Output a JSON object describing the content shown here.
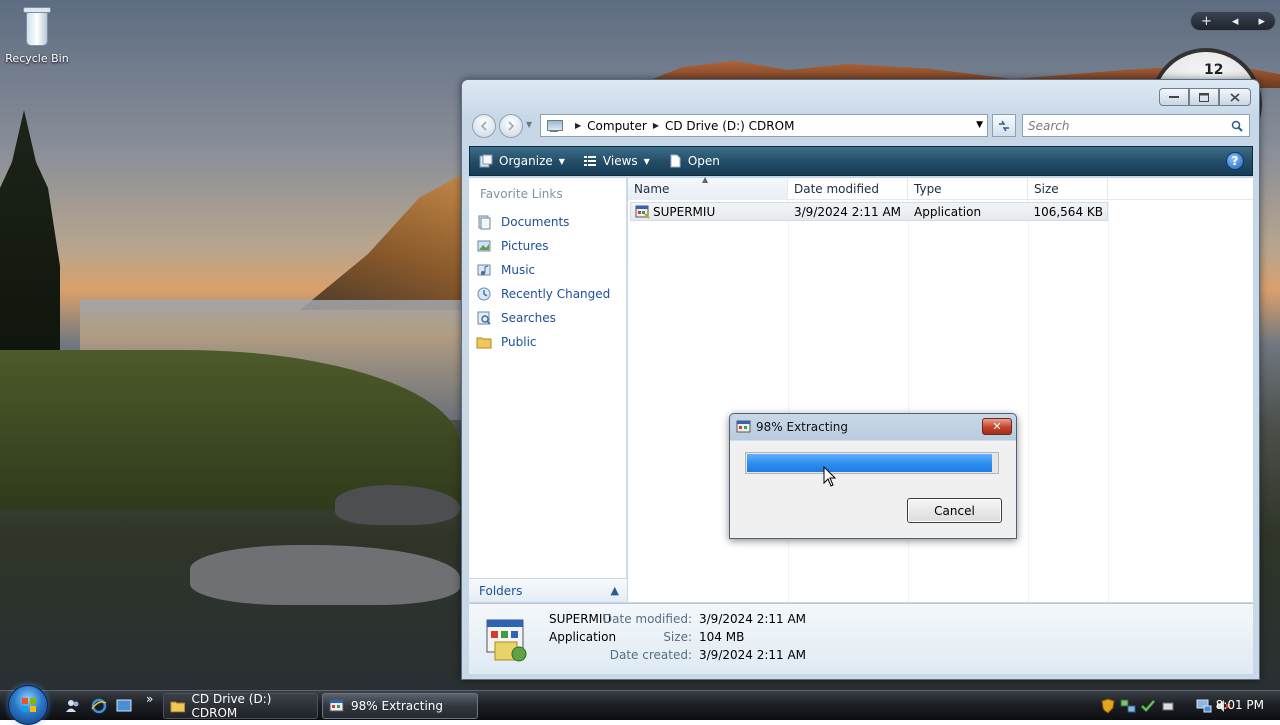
{
  "desktop": {
    "recycle_bin_label": "Recycle Bin",
    "clock_gadget_number": "12",
    "gadget_controls": {
      "add": "+",
      "prev": "◂",
      "next": "▸"
    }
  },
  "explorer": {
    "breadcrumb": [
      "Computer",
      "CD Drive (D:) CDROM"
    ],
    "search_placeholder": "Search",
    "toolbar": {
      "organize": "Organize",
      "views": "Views",
      "open": "Open",
      "help": "?"
    },
    "nav_pane": {
      "title": "Favorite Links",
      "links": [
        {
          "label": "Documents",
          "icon": "documents-icon"
        },
        {
          "label": "Pictures",
          "icon": "pictures-icon"
        },
        {
          "label": "Music",
          "icon": "music-icon"
        },
        {
          "label": "Recently Changed",
          "icon": "recently-changed-icon"
        },
        {
          "label": "Searches",
          "icon": "searches-icon"
        },
        {
          "label": "Public",
          "icon": "public-folder-icon"
        }
      ],
      "folders_label": "Folders"
    },
    "columns": {
      "name": "Name",
      "date": "Date modified",
      "type": "Type",
      "size": "Size"
    },
    "files": [
      {
        "name": "SUPERMIU",
        "date": "3/9/2024 2:11 AM",
        "type": "Application",
        "size": "106,564 KB"
      }
    ],
    "details": {
      "name": "SUPERMIU",
      "kind": "Application",
      "date_modified_label": "Date modified:",
      "date_modified": "3/9/2024 2:11 AM",
      "size_label": "Size:",
      "size": "104 MB",
      "date_created_label": "Date created:",
      "date_created": "3/9/2024 2:11 AM"
    }
  },
  "dialog": {
    "title": "98% Extracting",
    "progress_fraction": 0.98,
    "cancel_label": "Cancel",
    "close_glyph": "✕"
  },
  "taskbar": {
    "quick_launch_more": "»",
    "buttons": [
      {
        "label": "CD Drive (D:) CDROM",
        "icon": "folder-icon"
      },
      {
        "label": "98% Extracting",
        "icon": "installer-icon"
      }
    ],
    "time": "8:01 PM"
  },
  "colors": {
    "toolbar_bg": "#244e68",
    "link_blue": "#1e4f97",
    "progress_blue": "#2f8ef0",
    "close_red": "#c3422b"
  }
}
